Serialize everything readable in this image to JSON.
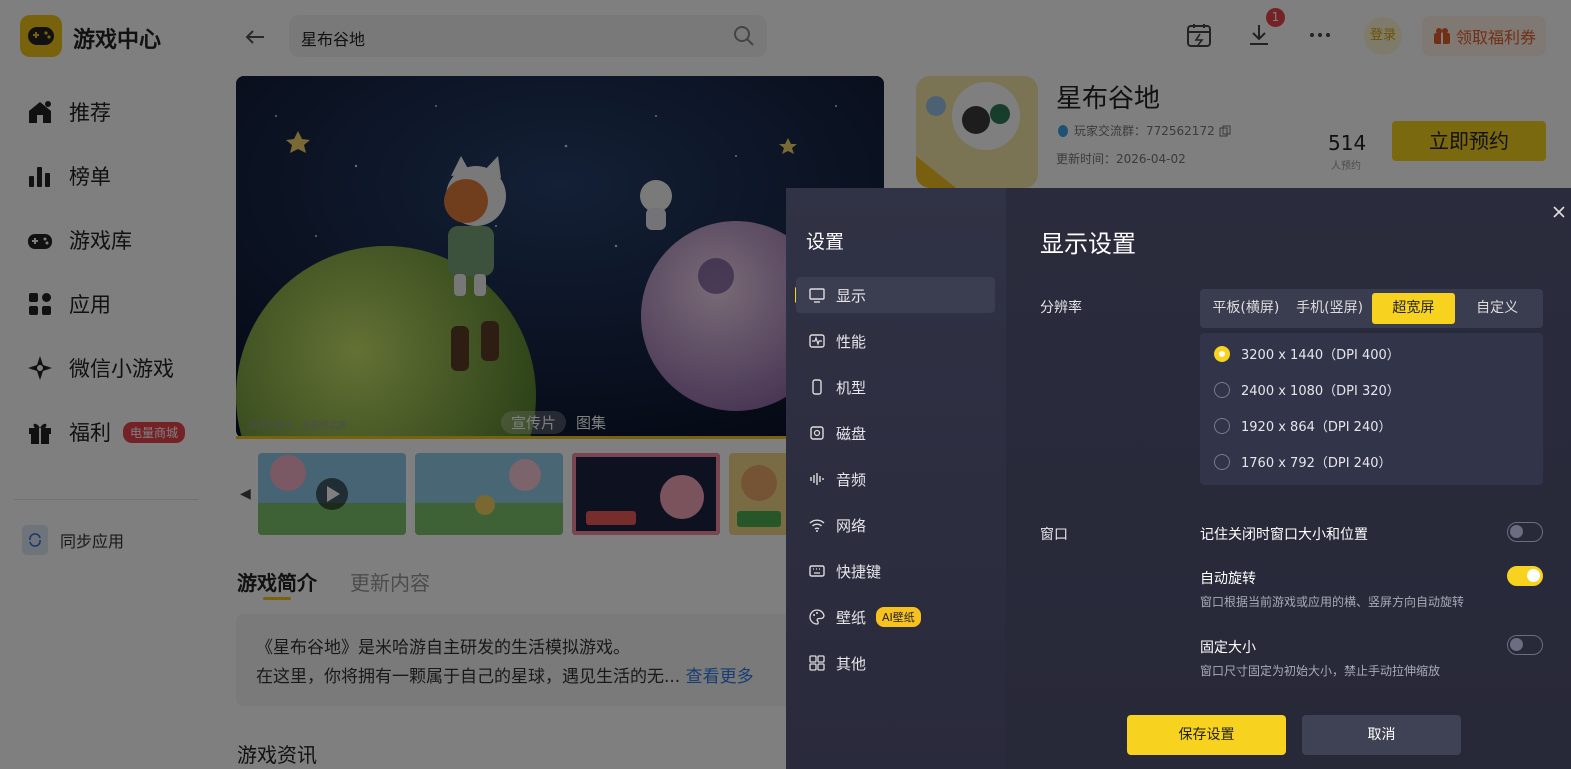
{
  "app": {
    "title": "游戏中心"
  },
  "sidebar": {
    "items": [
      {
        "label": "推荐",
        "icon": "home-icon"
      },
      {
        "label": "榜单",
        "icon": "chart-icon"
      },
      {
        "label": "游戏库",
        "icon": "gamepad-icon"
      },
      {
        "label": "应用",
        "icon": "apps-icon"
      },
      {
        "label": "微信小游戏",
        "icon": "wechat-game-icon"
      },
      {
        "label": "福利",
        "icon": "gift-icon",
        "badge": "电量商城"
      }
    ],
    "sync_label": "同步应用"
  },
  "header": {
    "search_value": "星布谷地",
    "download_badge": "1",
    "login_label": "登录",
    "welfare_label": "领取福利券"
  },
  "hero": {
    "tags": [
      "宣传片",
      "图集"
    ],
    "note": "游戏开发中，非最终品质"
  },
  "game": {
    "name": "星布谷地",
    "qq_group": "玩家交流群：772562172",
    "updated": "更新时间：2026-04-02",
    "reserve_count": "514",
    "reserve_count_label": "人预约",
    "reserve_button": "立即预约"
  },
  "tabs": [
    "游戏简介",
    "更新内容"
  ],
  "intro": {
    "line1": "《星布谷地》是米哈游自主研发的生活模拟游戏。",
    "line2": "在这里，你将拥有一颗属于自己的星球，遇见生活的无...",
    "more": "查看更多"
  },
  "news_title": "游戏资讯",
  "settings": {
    "title": "设置",
    "nav": [
      {
        "label": "显示",
        "icon": "display-icon"
      },
      {
        "label": "性能",
        "icon": "performance-icon"
      },
      {
        "label": "机型",
        "icon": "phone-model-icon"
      },
      {
        "label": "磁盘",
        "icon": "disk-icon"
      },
      {
        "label": "音频",
        "icon": "audio-icon"
      },
      {
        "label": "网络",
        "icon": "wifi-icon"
      },
      {
        "label": "快捷键",
        "icon": "keyboard-icon"
      },
      {
        "label": "壁纸",
        "icon": "palette-icon",
        "badge": "AI壁纸"
      },
      {
        "label": "其他",
        "icon": "grid-icon"
      }
    ],
    "section_title": "显示设置",
    "resolution_label": "分辨率",
    "resolution_tabs": [
      "平板(横屏)",
      "手机(竖屏)",
      "超宽屏",
      "自定义"
    ],
    "resolution_selected_tab": "超宽屏",
    "resolutions": [
      {
        "label": "3200 x 1440（DPI 400）",
        "selected": true
      },
      {
        "label": "2400 x 1080（DPI 320）",
        "selected": false
      },
      {
        "label": "1920 x 864（DPI 240）",
        "selected": false
      },
      {
        "label": "1760 x 792（DPI 240）",
        "selected": false
      }
    ],
    "window_label": "窗口",
    "options": [
      {
        "title": "记住关闭时窗口大小和位置",
        "desc": "",
        "on": false
      },
      {
        "title": "自动旋转",
        "desc": "窗口根据当前游戏或应用的横、竖屏方向自动旋转",
        "on": true
      },
      {
        "title": "固定大小",
        "desc": "窗口尺寸固定为初始大小，禁止手动拉伸缩放",
        "on": false
      }
    ],
    "save_label": "保存设置",
    "cancel_label": "取消"
  },
  "colors": {
    "accent": "#f7d21f",
    "badge_red": "#e8454a",
    "link": "#2f7ae5",
    "dialog_bg": "#2a2c3d"
  }
}
